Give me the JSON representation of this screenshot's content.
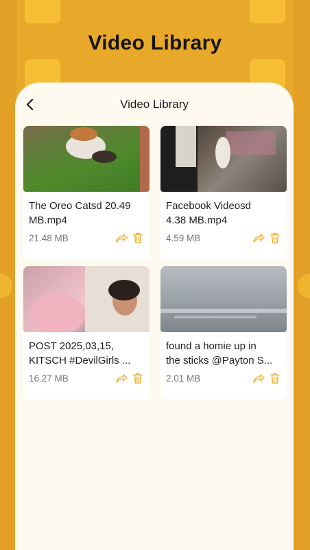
{
  "app": {
    "title": "Video Library"
  },
  "header": {
    "title": "Video Library"
  },
  "videos": [
    {
      "name": "The Oreo Catsd 20.49\nMB.mp4",
      "size": "21.48 MB"
    },
    {
      "name": "Facebook Videosd\n4.38 MB.mp4",
      "size": "4.59 MB"
    },
    {
      "name": "POST 2025,03,15,\nKITSCH #DevilGirls ...",
      "size": "16.27 MB"
    },
    {
      "name": "found a homie up in\nthe sticks @Payton S...",
      "size": "2.01 MB"
    }
  ],
  "colors": {
    "background": "#E8A92A",
    "accent": "#F0B530",
    "panel": "#FEFAF0",
    "icon": "#EDB13A"
  },
  "icons": [
    "back-arrow-icon",
    "share-icon",
    "trash-icon"
  ]
}
